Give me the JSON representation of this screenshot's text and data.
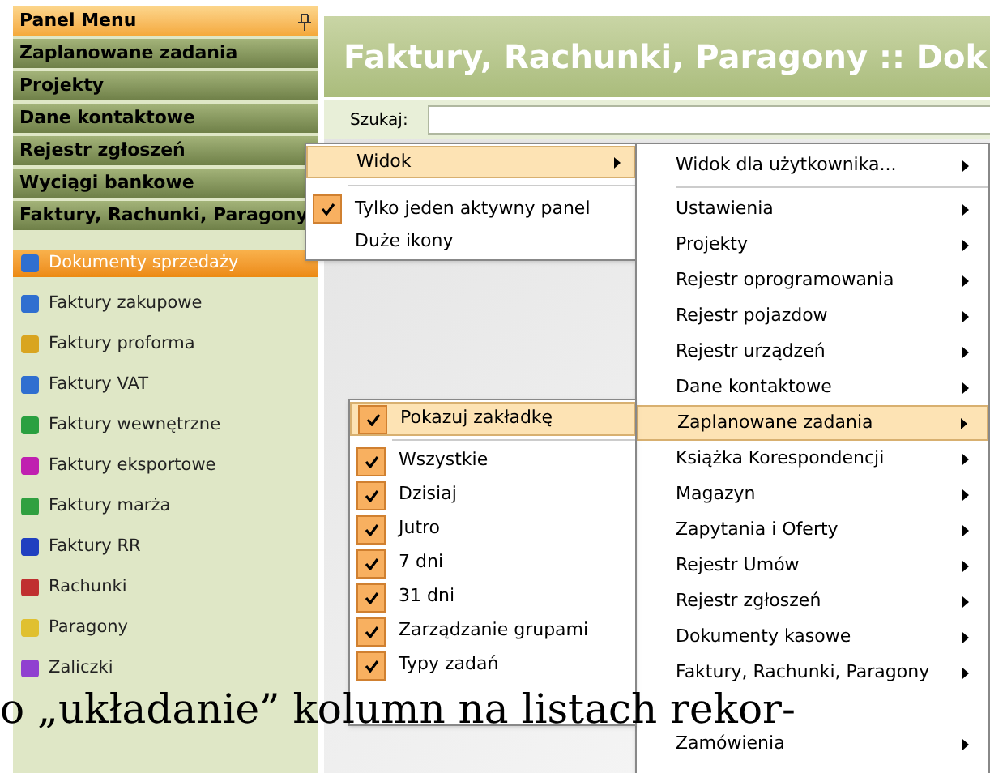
{
  "panel_menu": {
    "title": "Panel Menu",
    "groups": [
      {
        "label": "Zaplanowane zadania"
      },
      {
        "label": "Projekty"
      },
      {
        "label": "Dane kontaktowe"
      },
      {
        "label": "Rejestr zgłoszeń"
      },
      {
        "label": "Wyciągi bankowe"
      },
      {
        "label": "Faktury, Rachunki, Paragony"
      }
    ],
    "items": [
      {
        "label": "Dokumenty sprzedaży",
        "selected": true,
        "color": "#2f6fd0"
      },
      {
        "label": "Faktury zakupowe",
        "selected": false,
        "color": "#2f6fd0"
      },
      {
        "label": "Faktury proforma",
        "selected": false,
        "color": "#d9a520"
      },
      {
        "label": "Faktury VAT",
        "selected": false,
        "color": "#2f6fd0"
      },
      {
        "label": "Faktury wewnętrzne",
        "selected": false,
        "color": "#2aa040"
      },
      {
        "label": "Faktury eksportowe",
        "selected": false,
        "color": "#c020b0"
      },
      {
        "label": "Faktury marża",
        "selected": false,
        "color": "#30a040"
      },
      {
        "label": "Faktury RR",
        "selected": false,
        "color": "#2040c0"
      },
      {
        "label": "Rachunki",
        "selected": false,
        "color": "#c03030"
      },
      {
        "label": "Paragony",
        "selected": false,
        "color": "#e0c030"
      },
      {
        "label": "Zaliczki",
        "selected": false,
        "color": "#9040d0"
      }
    ]
  },
  "main": {
    "title": "Faktury, Rachunki, Paragony :: Dok",
    "search": {
      "label": "Szukaj:"
    }
  },
  "context_menu": [
    {
      "label": "Widok",
      "selected": true,
      "checked": false,
      "submenu": true
    },
    {
      "label": "Tylko jeden aktywny panel",
      "selected": false,
      "checked": true,
      "submenu": false
    },
    {
      "label": "Duże ikony",
      "selected": false,
      "checked": false,
      "submenu": false
    }
  ],
  "view_menu": [
    {
      "label": "Widok dla użytkownika...",
      "selected": false
    },
    {
      "label": "Ustawienia",
      "selected": false
    },
    {
      "label": "Projekty",
      "selected": false
    },
    {
      "label": "Rejestr oprogramowania",
      "selected": false
    },
    {
      "label": "Rejestr pojazdow",
      "selected": false
    },
    {
      "label": "Rejestr urządzeń",
      "selected": false
    },
    {
      "label": "Dane kontaktowe",
      "selected": false
    },
    {
      "label": "Zaplanowane zadania",
      "selected": true
    },
    {
      "label": "Książka Korespondencji",
      "selected": false
    },
    {
      "label": "Magazyn",
      "selected": false
    },
    {
      "label": "Zapytania i Oferty",
      "selected": false
    },
    {
      "label": "Rejestr Umów",
      "selected": false
    },
    {
      "label": "Rejestr zgłoszeń",
      "selected": false
    },
    {
      "label": "Dokumenty kasowe",
      "selected": false
    },
    {
      "label": "Faktury, Rachunki, Paragony",
      "selected": false
    },
    {
      "label": "Zamówienia",
      "selected": false
    }
  ],
  "tasks_menu": [
    {
      "label": "Pokazuj zakładkę",
      "selected": true,
      "checked": true
    },
    {
      "label": "Wszystkie",
      "selected": false,
      "checked": true
    },
    {
      "label": "Dzisiaj",
      "selected": false,
      "checked": true
    },
    {
      "label": "Jutro",
      "selected": false,
      "checked": true
    },
    {
      "label": "7 dni",
      "selected": false,
      "checked": true
    },
    {
      "label": "31 dni",
      "selected": false,
      "checked": true
    },
    {
      "label": "Zarządzanie grupami",
      "selected": false,
      "checked": true
    },
    {
      "label": "Typy zadań",
      "selected": false,
      "checked": true
    }
  ],
  "document_text": [
    "o „układanie” kolumn na listach rekor-"
  ]
}
